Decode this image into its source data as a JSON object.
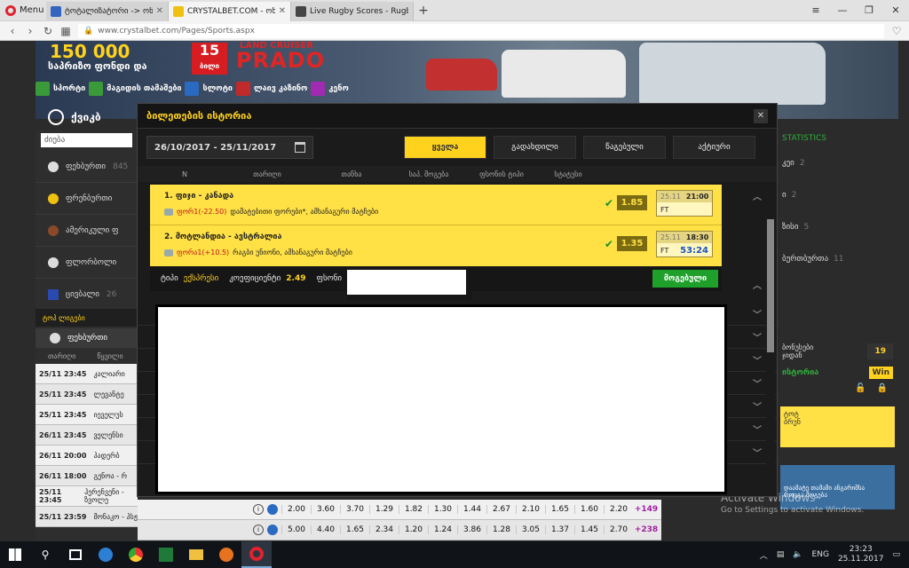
{
  "browser": {
    "menu_label": "Menu",
    "tabs": [
      {
        "title": "ტოტალიზატორი -> ონ",
        "active": false,
        "color": "#3563c0"
      },
      {
        "title": "CRYSTALBET.COM - ონლ",
        "active": true,
        "color": "#f0c010"
      },
      {
        "title": "Live Rugby Scores - Rugby",
        "active": false,
        "color": "#444444"
      }
    ],
    "address": "www.crystalbet.com/Pages/Sports.aspx"
  },
  "banner": {
    "amount": "150 000",
    "fund_text": "საპრიზო ფონდი და",
    "promo_number": "15",
    "promo_sub": "ბილი",
    "landcruiser": "LAND CRUISER",
    "prado": "PRADO",
    "nav": [
      {
        "label": "სპორტი",
        "color": "#3a9a3a"
      },
      {
        "label": "მაგიდის თამაშები",
        "color": "#3a9a3a"
      },
      {
        "label": "სლოტი",
        "color": "#2a6ac0"
      },
      {
        "label": "ლაივ კაზინო",
        "color": "#c02a2a"
      },
      {
        "label": "კენო",
        "color": "#a02ab0"
      }
    ],
    "quickbet": "ქვიკბ"
  },
  "sidebar": {
    "search_placeholder": "ძიება",
    "sports": [
      {
        "name": "ფეხბურთი",
        "count": "845",
        "color": "#dddddd"
      },
      {
        "name": "ფრენბურთი",
        "count": "",
        "color": "#f0c010"
      },
      {
        "name": "ამერიკული ფ",
        "count": "",
        "color": "#8a4a2a"
      },
      {
        "name": "ფლორბოლი",
        "count": "",
        "color": "#dddddd"
      },
      {
        "name": "ცივბალი",
        "count": "26",
        "color": "#2a4ab0"
      }
    ],
    "top_leagues": "ტოპ ლიგები",
    "match_head": "ფეხბურთი",
    "col_date": "თარიღი",
    "col_match": "წყვილი",
    "matches": [
      {
        "time": "25/11 23:45",
        "team": "კალიარი"
      },
      {
        "time": "25/11 23:45",
        "team": "ლევანტე"
      },
      {
        "time": "25/11 23:45",
        "team": "იეველუს"
      },
      {
        "time": "26/11 23:45",
        "team": "ველენსი"
      },
      {
        "time": "26/11 20:00",
        "team": "პადერბ"
      },
      {
        "time": "26/11 18:00",
        "team": "გენოა - რ"
      },
      {
        "time": "25/11 23:45",
        "team": "ჰერენვენი - ზვოლე"
      },
      {
        "time": "25/11 23:59",
        "team": "მონაკო - პსჟ"
      }
    ]
  },
  "odds_rows": [
    {
      "odds": [
        "2.00",
        "3.60",
        "3.70",
        "1.29",
        "1.82",
        "1.30",
        "1.44",
        "2.67",
        "2.10",
        "1.65",
        "1.60",
        "2.20"
      ],
      "plus": "+149"
    },
    {
      "odds": [
        "5.00",
        "4.40",
        "1.65",
        "2.34",
        "1.20",
        "1.24",
        "3.86",
        "1.28",
        "3.05",
        "1.37",
        "1.45",
        "2.70"
      ],
      "plus": "+238"
    }
  ],
  "right_pane": {
    "statistics": "STATISTICS",
    "items": [
      {
        "label": "კეი",
        "count": "2"
      },
      {
        "label": "ი",
        "count": "2"
      },
      {
        "label": "ზისი",
        "count": "5"
      },
      {
        "label": "ბურთბურთა",
        "count": "11"
      }
    ],
    "bonus_label": "ბონუსები",
    "bonus_sub": "ჯიდან",
    "bonus_count": "19",
    "history_label": "ისტორია",
    "win_label": "Win",
    "yellow_text1": "ტოტ",
    "yellow_text2": "ბრუნ",
    "bottom_text1": "დაამატე თამაში ანგარიშსა",
    "bottom_text2": "როცგა მოგება"
  },
  "activate": {
    "line1": "Activate Windows",
    "line2": "Go to Settings to activate Windows."
  },
  "modal": {
    "title": "ბილეთების ისტორია",
    "date_range": "26/10/2017 - 25/11/2017",
    "filters": [
      {
        "label": "ყველა",
        "active": true
      },
      {
        "label": "გადახდილი",
        "active": false
      },
      {
        "label": "წაგებული",
        "active": false
      },
      {
        "label": "აქტიური",
        "active": false
      }
    ],
    "columns": [
      "N",
      "თარიღი",
      "თანხა",
      "საპ. მოგება",
      "ფსონის ტიპი",
      "სტატუსი"
    ],
    "legs": [
      {
        "title": "1. ფიჯი - კანადა",
        "market_red": "ფორ1(-22.50)",
        "market_rest": "დამატებითი ფორები*, ამხანაგური მატჩები",
        "odd": "1.85",
        "date": "25.11",
        "time": "21:00",
        "status": "FT",
        "score": ""
      },
      {
        "title": "2. მოტლანდია - ავსტრალია",
        "market_red": "ფორა1(+10.5)",
        "market_rest": "რაგბი უნიონი, ამხანაგური მატჩები",
        "odd": "1.35",
        "date": "25.11",
        "time": "18:30",
        "status": "FT",
        "score": "53:24"
      }
    ],
    "footer": {
      "type_label": "ტიპი",
      "type_value": "ექსპრესი",
      "coef_label": "კოეფიციენტი",
      "coef_value": "2.49",
      "stake_label": "ფსონი",
      "win_button": "მოგებული"
    }
  },
  "taskbar": {
    "lang": "ENG",
    "time": "23:23",
    "date": "25.11.2017"
  }
}
